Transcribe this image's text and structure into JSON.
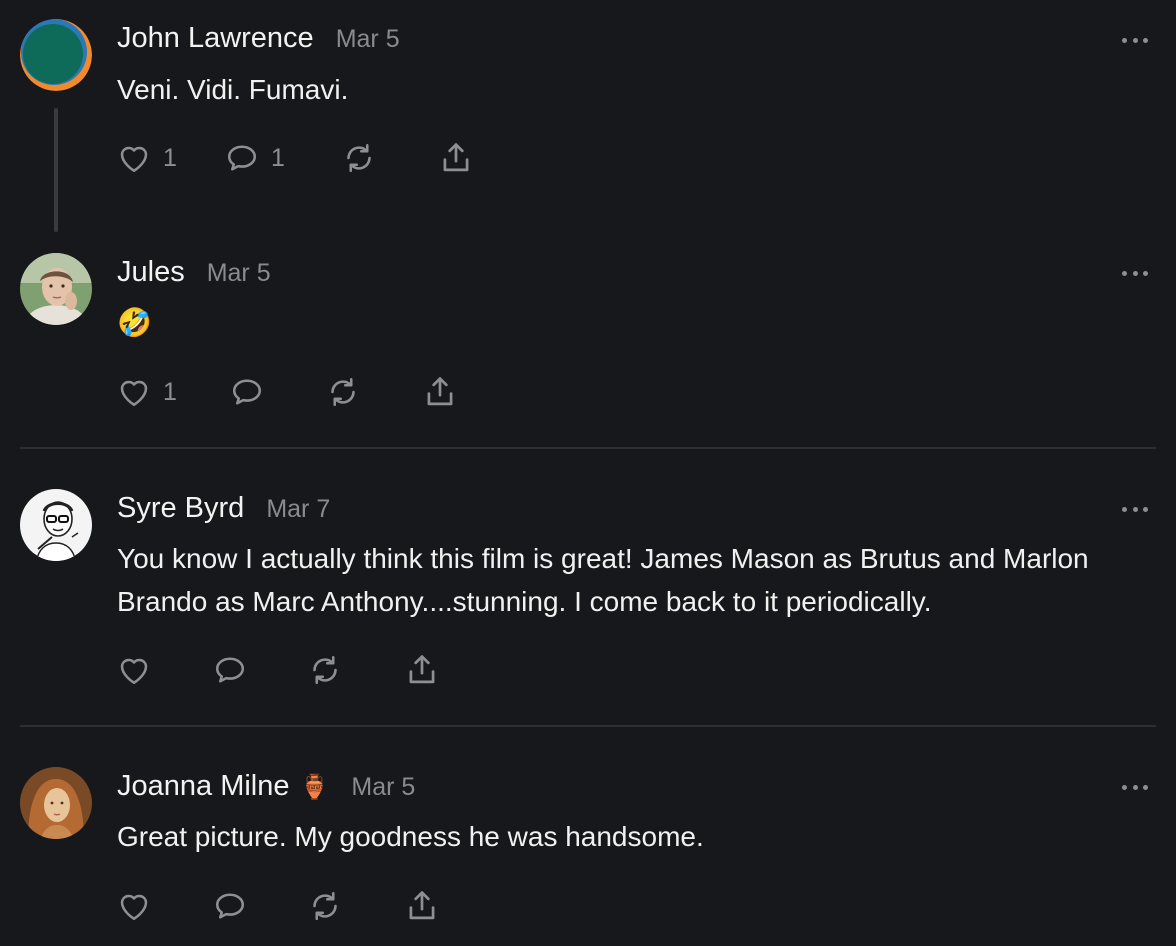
{
  "comments": [
    {
      "author": "John Lawrence",
      "flair": "",
      "date": "Mar 5",
      "text": "Veni. Vidi. Fumavi.",
      "likes": "1",
      "replies": "1",
      "avatar": "abstract-green-orange-avatar"
    },
    {
      "author": "Jules",
      "flair": "",
      "date": "Mar 5",
      "text": "🤣",
      "likes": "1",
      "replies": "",
      "avatar": "woman-photo-avatar"
    },
    {
      "author": "Syre Byrd",
      "flair": "",
      "date": "Mar 7",
      "text": "You know I actually think this film is great! James Mason as Brutus and Marlon Brando as Marc Anthony....stunning. I come back to it periodically.",
      "likes": "",
      "replies": "",
      "avatar": "man-sketch-avatar"
    },
    {
      "author": "Joanna Milne",
      "flair": "🏺",
      "date": "Mar 5",
      "text": "Great picture. My goodness he was handsome.",
      "likes": "",
      "replies": "",
      "avatar": "painting-portrait-avatar"
    }
  ],
  "colors": {
    "background": "#17181b",
    "text": "#f2f2f2",
    "muted": "#8b8b8f",
    "divider": "#2e2f33"
  },
  "icons": [
    "heart-icon",
    "comment-icon",
    "restack-icon",
    "share-icon",
    "more-icon"
  ]
}
